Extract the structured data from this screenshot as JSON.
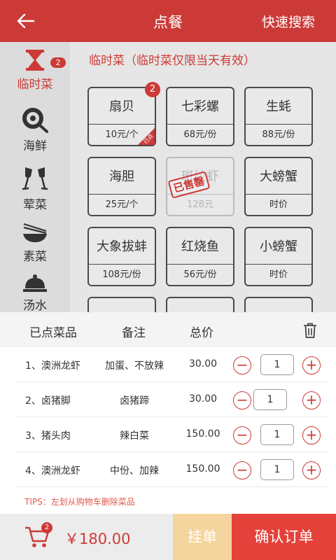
{
  "header": {
    "title": "点餐",
    "quick_search": "快速搜索"
  },
  "sidebar": {
    "items": [
      {
        "label": "临时菜",
        "icon": "hourglass-icon",
        "badge": "2",
        "active": true
      },
      {
        "label": "海鲜",
        "icon": "frying-pan-icon"
      },
      {
        "label": "荤菜",
        "icon": "wine-glasses-icon"
      },
      {
        "label": "素菜",
        "icon": "bowl-chopsticks-icon"
      },
      {
        "label": "汤水",
        "icon": "cloche-icon"
      }
    ]
  },
  "section_title": "临时菜（临时菜仅限当天有效）",
  "dishes": [
    {
      "name": "扇贝",
      "price": "10元/个",
      "badge": "2",
      "corner": "已点"
    },
    {
      "name": "七彩螺",
      "price": "68元/份"
    },
    {
      "name": "生蚝",
      "price": "88元/份"
    },
    {
      "name": "海胆",
      "price": "25元/个"
    },
    {
      "name": "斑纹虾",
      "price": "128元",
      "stamp": "已售罄"
    },
    {
      "name": "大螃蟹",
      "price": "时价"
    },
    {
      "name": "大象拔蚌",
      "price": "108元/份"
    },
    {
      "name": "红烧鱼",
      "price": "56元/份"
    },
    {
      "name": "小螃蟹",
      "price": "时价"
    }
  ],
  "cart": {
    "headers": {
      "dish": "已点菜品",
      "note": "备注",
      "total": "总价"
    },
    "rows": [
      {
        "name": "1、澳洲龙虾",
        "note": "加蛋、不放辣",
        "total": "30.00",
        "qty": "1"
      },
      {
        "name": "2、卤猪脚",
        "note": "卤猪蹄",
        "total": "30.00",
        "qty": "1"
      },
      {
        "name": "3、猪头肉",
        "note": "辣白菜",
        "total": "150.00",
        "qty": "1"
      },
      {
        "name": "4、澳洲龙虾",
        "note": "中份、加辣",
        "total": "150.00",
        "qty": "1"
      }
    ],
    "minus": "−",
    "plus": "+",
    "tips": "TIPS：左划从购物车删除菜品"
  },
  "bottom": {
    "cart_badge": "2",
    "total": "￥180.00",
    "hold": "挂单",
    "confirm": "确认订单"
  },
  "colors": {
    "brand": "#cc3a37",
    "hold": "#f5d59e",
    "confirm": "#e5413b"
  }
}
